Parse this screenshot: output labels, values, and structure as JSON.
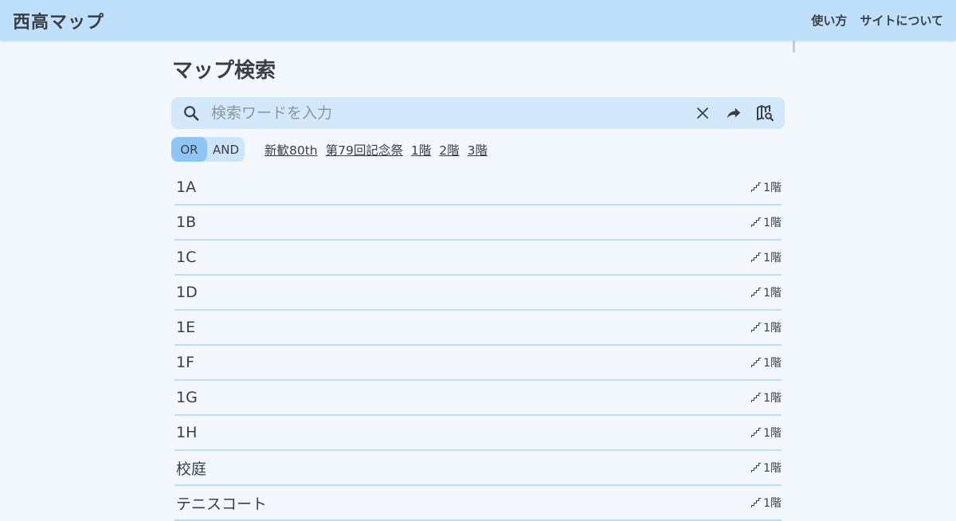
{
  "header": {
    "title": "西高マップ",
    "nav": [
      "使い方",
      "サイトについて"
    ]
  },
  "page": {
    "title": "マップ検索"
  },
  "search": {
    "placeholder": "検索ワードを入力",
    "value": "",
    "icons": [
      "search-icon",
      "clear-icon",
      "share-icon",
      "map-search-icon"
    ]
  },
  "filter": {
    "mode_options": [
      "OR",
      "AND"
    ],
    "selected_mode": "OR",
    "tags": [
      "新歓80th",
      "第79回記念祭",
      "1階",
      "2階",
      "3階"
    ]
  },
  "results": [
    {
      "name": "1A",
      "floor": "1階"
    },
    {
      "name": "1B",
      "floor": "1階"
    },
    {
      "name": "1C",
      "floor": "1階"
    },
    {
      "name": "1D",
      "floor": "1階"
    },
    {
      "name": "1E",
      "floor": "1階"
    },
    {
      "name": "1F",
      "floor": "1階"
    },
    {
      "name": "1G",
      "floor": "1階"
    },
    {
      "name": "1H",
      "floor": "1階"
    },
    {
      "name": "校庭",
      "floor": "1階"
    },
    {
      "name": "テニスコート",
      "floor": "1階"
    }
  ],
  "colors": {
    "header_bg": "#bfe0fb",
    "page_bg": "#f3f8fe",
    "search_bg": "#d3e9fb",
    "toggle_active": "#8ec7f5",
    "divider": "#b9def8",
    "text": "#3a3f45"
  }
}
